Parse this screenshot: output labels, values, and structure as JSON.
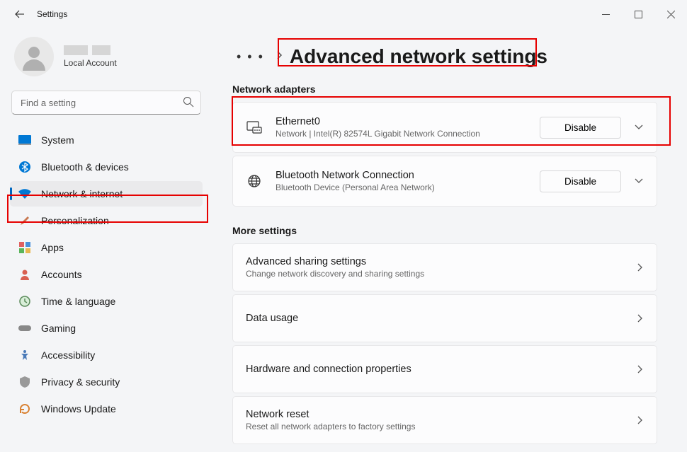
{
  "window": {
    "title": "Settings"
  },
  "profile": {
    "subtitle": "Local Account"
  },
  "search": {
    "placeholder": "Find a setting"
  },
  "sidebar": {
    "items": [
      {
        "label": "System"
      },
      {
        "label": "Bluetooth & devices"
      },
      {
        "label": "Network & internet"
      },
      {
        "label": "Personalization"
      },
      {
        "label": "Apps"
      },
      {
        "label": "Accounts"
      },
      {
        "label": "Time & language"
      },
      {
        "label": "Gaming"
      },
      {
        "label": "Accessibility"
      },
      {
        "label": "Privacy & security"
      },
      {
        "label": "Windows Update"
      }
    ]
  },
  "header": {
    "ellipsis": "• • •",
    "title": "Advanced network settings"
  },
  "sections": {
    "adapters_label": "Network adapters",
    "more_label": "More settings"
  },
  "adapters": [
    {
      "title": "Ethernet0",
      "subtitle": "Network | Intel(R) 82574L Gigabit Network Connection",
      "action": "Disable"
    },
    {
      "title": "Bluetooth Network Connection",
      "subtitle": "Bluetooth Device (Personal Area Network)",
      "action": "Disable"
    }
  ],
  "more": [
    {
      "title": "Advanced sharing settings",
      "subtitle": "Change network discovery and sharing settings"
    },
    {
      "title": "Data usage",
      "subtitle": ""
    },
    {
      "title": "Hardware and connection properties",
      "subtitle": ""
    },
    {
      "title": "Network reset",
      "subtitle": "Reset all network adapters to factory settings"
    }
  ]
}
